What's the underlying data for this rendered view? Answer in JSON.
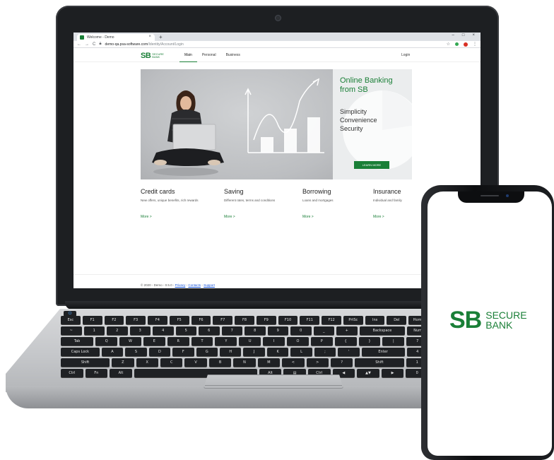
{
  "browser": {
    "tab_title": "Welcome - Demo",
    "tab_close": "×",
    "new_tab": "+",
    "url_host": "demo-qa.psa-software.com",
    "url_path": "/Identity/Account/Login",
    "win_minimize": "–",
    "win_maximize": "□",
    "win_close": "×"
  },
  "site": {
    "logo_mark": "SB",
    "logo_line1": "SECURE",
    "logo_line2": "BANK",
    "nav": [
      "Main",
      "Personal",
      "Business"
    ],
    "login": "Login",
    "hero": {
      "title": "Online Banking from SB",
      "lines": [
        "Simplicity",
        "Convenience",
        "Security"
      ],
      "button": "LEARN MORE"
    },
    "features": [
      {
        "title": "Credit cards",
        "desc": "New offers, unique benefits, rich rewards",
        "more": "More >"
      },
      {
        "title": "Saving",
        "desc": "Different rates, terms and conditions",
        "more": "More >"
      },
      {
        "title": "Borrowing",
        "desc": "Loans and mortgages",
        "more": "More >"
      },
      {
        "title": "Insurance",
        "desc": "Individual and family",
        "more": "More >"
      }
    ],
    "footer": {
      "text": "© 2020 - Demo - 0.5.0 - ",
      "links": [
        "Privacy",
        "Contacts",
        "Support"
      ]
    }
  },
  "keyboard": {
    "rows": [
      [
        "Esc",
        "F1",
        "F2",
        "F3",
        "F4",
        "F5",
        "F6",
        "F7",
        "F8",
        "F9",
        "F10",
        "F11",
        "F12",
        "PrtSc",
        "Ins",
        "Del",
        "Home"
      ],
      [
        "~",
        "1",
        "2",
        "3",
        "4",
        "5",
        "6",
        "7",
        "8",
        "9",
        "0",
        "_",
        "+",
        "Backspace",
        "Num"
      ],
      [
        "Tab",
        "Q",
        "W",
        "E",
        "R",
        "T",
        "Y",
        "U",
        "I",
        "O",
        "P",
        "{",
        "}",
        "|",
        "7"
      ],
      [
        "Caps Lock",
        "A",
        "S",
        "D",
        "F",
        "G",
        "H",
        "J",
        "K",
        "L",
        ";",
        "'",
        "Enter",
        "4"
      ],
      [
        "Shift",
        "Z",
        "X",
        "C",
        "V",
        "B",
        "N",
        "M",
        "<",
        ">",
        "?",
        "Shift",
        "1"
      ],
      [
        "Ctrl",
        "Fn",
        "Alt",
        "",
        "Alt",
        "▤",
        "Ctrl",
        "◀",
        "▲▼",
        "▶",
        "0"
      ]
    ]
  },
  "phone": {
    "logo_mark": "SB",
    "logo_line1": "SECURE",
    "logo_line2": "BANK"
  },
  "colors": {
    "brand_green": "#1a7f37",
    "laptop_frame": "#1d1f22",
    "laptop_body": "#c5c7ca"
  },
  "icons": [
    "back-icon",
    "forward-icon",
    "reload-icon",
    "lock-icon",
    "star-icon",
    "menu-icon",
    "power-icon"
  ]
}
